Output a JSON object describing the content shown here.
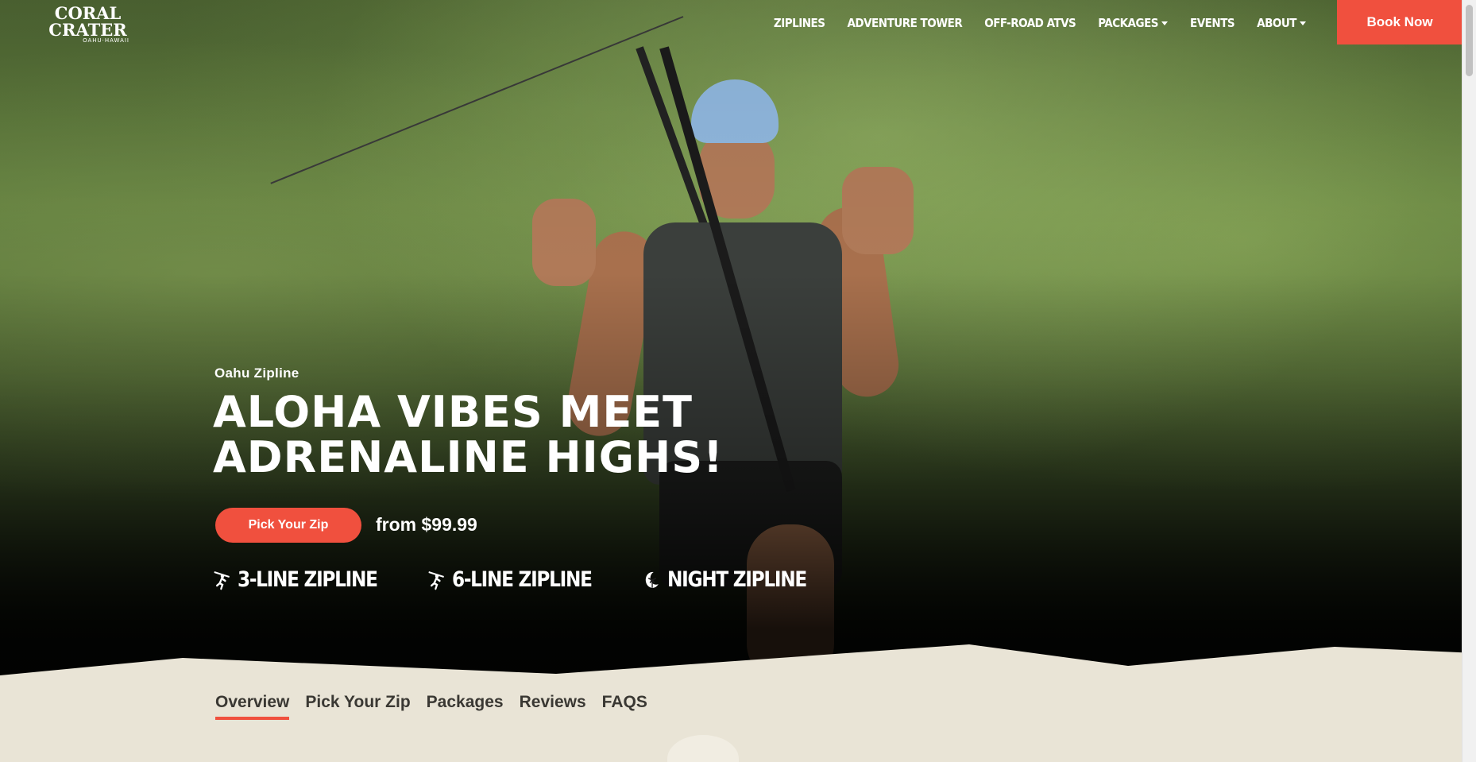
{
  "brand": {
    "logo_line1": "CORAL",
    "logo_line2": "CRATER",
    "logo_line3": "OAHU·HAWAII"
  },
  "nav": {
    "items": [
      {
        "label": "ZIPLINES",
        "has_dropdown": false
      },
      {
        "label": "ADVENTURE TOWER",
        "has_dropdown": false
      },
      {
        "label": "OFF-ROAD ATVS",
        "has_dropdown": false
      },
      {
        "label": "PACKAGES",
        "has_dropdown": true
      },
      {
        "label": "EVENTS",
        "has_dropdown": false
      },
      {
        "label": "ABOUT",
        "has_dropdown": true
      }
    ],
    "cta_label": "Book Now"
  },
  "hero": {
    "eyebrow": "Oahu Zipline",
    "headline_line1": "ALOHA VIBES MEET",
    "headline_line2": "ADRENALINE HIGHS!",
    "cta_label": "Pick Your Zip",
    "price": "from $99.99",
    "features": [
      {
        "label": "3-LINE ZIPLINE",
        "icon": "zipline-rider-icon"
      },
      {
        "label": "6-LINE ZIPLINE",
        "icon": "zipline-rider-icon"
      },
      {
        "label": "NIGHT ZIPLINE",
        "icon": "moon-palm-icon"
      }
    ]
  },
  "tabs": [
    {
      "label": "Overview",
      "active": true
    },
    {
      "label": "Pick Your Zip",
      "active": false
    },
    {
      "label": "Packages",
      "active": false
    },
    {
      "label": "Reviews",
      "active": false
    },
    {
      "label": "FAQS",
      "active": false
    }
  ],
  "colors": {
    "accent": "#f0503e",
    "background": "#e9e4d6",
    "text_dark": "#3a3833"
  }
}
